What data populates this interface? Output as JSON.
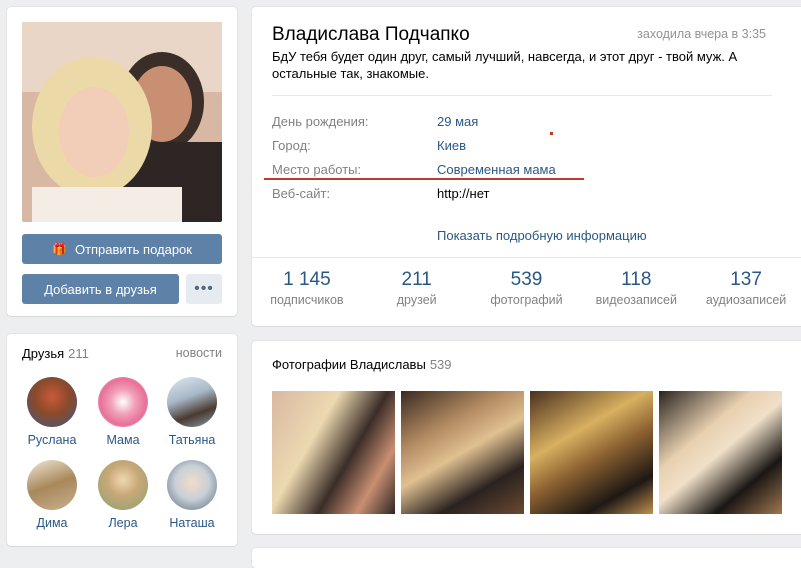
{
  "profile": {
    "name": "Владислава Подчапко",
    "online": "заходила вчера в 3:35",
    "status": "БдУ тебя будет один друг, самый лучший, навсегда, и этот друг - твой муж. А остальные так, знакомые.",
    "info": [
      {
        "label": "День рождения:",
        "value": "29 мая"
      },
      {
        "label": "Город:",
        "value": "Киев"
      },
      {
        "label": "Место работы:",
        "value": "Современная мама"
      },
      {
        "label": "Веб-сайт:",
        "value": "http://нет"
      }
    ],
    "show_more": "Показать подробную информацию",
    "counters": [
      {
        "number": "1 145",
        "label": "подписчиков"
      },
      {
        "number": "211",
        "label": "друзей"
      },
      {
        "number": "539",
        "label": "фотографий"
      },
      {
        "number": "118",
        "label": "видеозаписей"
      },
      {
        "number": "137",
        "label": "аудиозаписей"
      }
    ]
  },
  "actions": {
    "gift": "Отправить подарок",
    "add_friend": "Добавить в друзья",
    "more": "•••"
  },
  "friends": {
    "title": "Друзья",
    "count": "211",
    "news": "новости",
    "items": [
      {
        "name": "Руслана"
      },
      {
        "name": "Мама"
      },
      {
        "name": "Татьяна"
      },
      {
        "name": "Дима"
      },
      {
        "name": "Лера"
      },
      {
        "name": "Наташа"
      }
    ]
  },
  "photos": {
    "title": "Фотографии Владиславы",
    "count": "539"
  },
  "colors": {
    "accent": "#5e81a8",
    "link": "#2a5885",
    "annotation": "#c0392b"
  }
}
